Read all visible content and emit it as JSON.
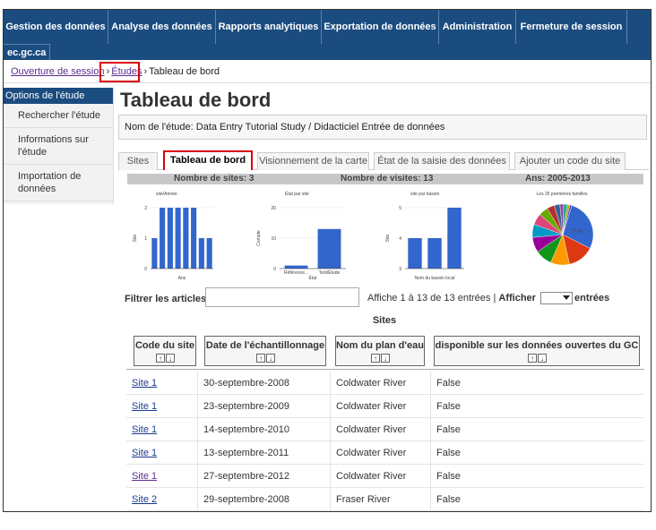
{
  "nav": {
    "items": [
      "Gestion des données",
      "Analyse des données",
      "Rapports analytiques",
      "Exportation de données",
      "Administration",
      "Fermeture de session"
    ],
    "second_row": "ec.gc.ca"
  },
  "breadcrumb": {
    "items": [
      "Ouverture de session",
      "Études",
      "Tableau de bord"
    ]
  },
  "sidebar": {
    "header": "Options de l'étude",
    "items": [
      "Rechercher l'étude",
      "Informations sur l'étude",
      "Importation de données"
    ]
  },
  "page": {
    "title": "Tableau de bord",
    "study_name": "Nom de l'étude: Data Entry Tutorial Study / Didacticiel Entrée de données"
  },
  "tabs": [
    "Sites",
    "Tableau de bord",
    "Visionnement de la carte",
    "État de la saisie des données",
    "Ajouter un code du site"
  ],
  "stats": {
    "sites": "Nombre de sites: 3",
    "visits": "Nombre de visites: 13",
    "years": "Ans: 2005-2013"
  },
  "chart_data": [
    {
      "type": "bar",
      "title": "site/Année",
      "ylabel": "Site",
      "xlabel": "Ans",
      "yticks": [
        "0",
        "1",
        "2"
      ],
      "ylim": [
        0,
        2
      ],
      "values": [
        1,
        2,
        2,
        2,
        2,
        2,
        1,
        1
      ]
    },
    {
      "type": "bar",
      "title": "État par site",
      "ylabel": "Compte",
      "xlabel": "État",
      "yticks": [
        "0",
        "10",
        "20"
      ],
      "ylim": [
        0,
        20
      ],
      "categories": [
        "Référence...",
        "Test/Étude"
      ],
      "values": [
        1,
        13
      ]
    },
    {
      "type": "bar",
      "title": "site par bassin",
      "ylabel": "Site",
      "xlabel": "Nom du bassin local",
      "yticks": [
        "3",
        "4",
        "5"
      ],
      "ylim": [
        3,
        5
      ],
      "values": [
        4,
        4,
        5
      ]
    },
    {
      "type": "pie",
      "title": "Les 25 premières familles",
      "label": "77.7%",
      "values": [
        27.7,
        14,
        10,
        9,
        8,
        7,
        6,
        5,
        4,
        3,
        2,
        2,
        1.3,
        1
      ],
      "colors": [
        "#3366cc",
        "#dc3912",
        "#ff9900",
        "#109618",
        "#990099",
        "#0099c6",
        "#dd4477",
        "#66aa00",
        "#b82e2e",
        "#316395",
        "#994499",
        "#22aa99",
        "#aaaa11",
        "#6633cc"
      ]
    }
  ],
  "filter": {
    "label": "Filtrer les articles",
    "info_prefix": "Affiche 1 à 13 de 13 entrées |",
    "show_label": "Afficher",
    "entries_label": "entrées"
  },
  "table": {
    "caption": "Sites",
    "headers": [
      "Code du site",
      "Date de l'échantillonnage",
      "Nom du plan d'eau",
      "disponible sur les données ouvertes du GC"
    ],
    "rows": [
      [
        "Site 1",
        "30-septembre-2008",
        "Coldwater River",
        "False"
      ],
      [
        "Site 1",
        "23-septembre-2009",
        "Coldwater River",
        "False"
      ],
      [
        "Site 1",
        "14-septembre-2010",
        "Coldwater River",
        "False"
      ],
      [
        "Site 1",
        "13-septembre-2011",
        "Coldwater River",
        "False"
      ],
      [
        "Site 1",
        "27-septembre-2012",
        "Coldwater River",
        "False"
      ],
      [
        "Site 2",
        "29-septembre-2008",
        "Fraser River",
        "False"
      ]
    ]
  }
}
